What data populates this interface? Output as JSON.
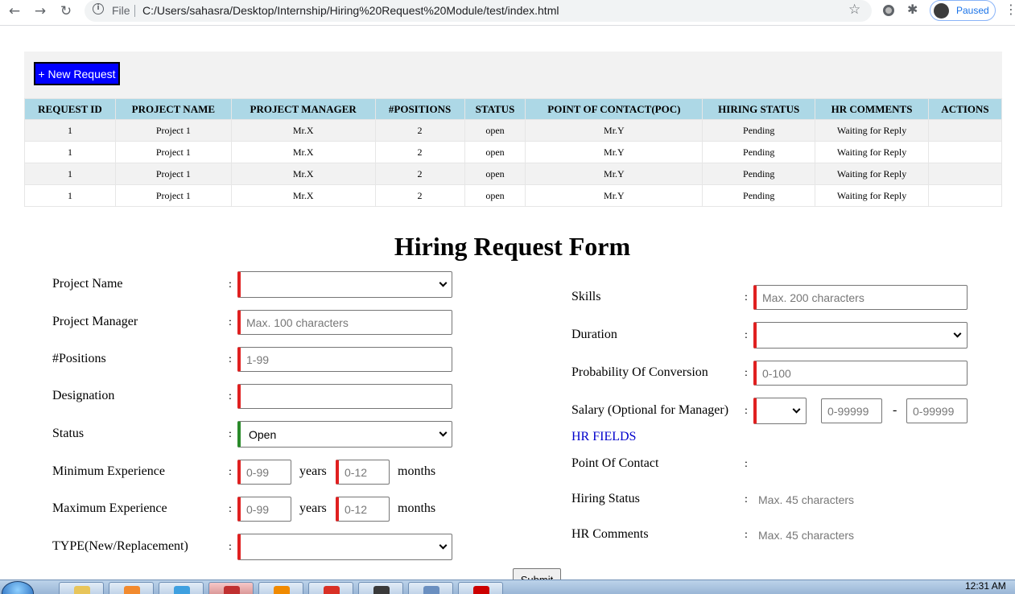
{
  "browser": {
    "file_label": "File",
    "url": "C:/Users/sahasra/Desktop/Internship/Hiring%20Request%20Module/test/index.html",
    "profile_label": "Paused"
  },
  "toolbar": {
    "new_request_label": "+ New Request"
  },
  "table": {
    "headers": [
      "REQUEST ID",
      "PROJECT NAME",
      "PROJECT MANAGER",
      "#POSITIONS",
      "STATUS",
      "POINT OF CONTACT(POC)",
      "HIRING STATUS",
      "HR COMMENTS",
      "ACTIONS"
    ],
    "rows": [
      [
        "1",
        "Project 1",
        "Mr.X",
        "2",
        "open",
        "Mr.Y",
        "Pending",
        "Waiting for Reply",
        ""
      ],
      [
        "1",
        "Project 1",
        "Mr.X",
        "2",
        "open",
        "Mr.Y",
        "Pending",
        "Waiting for Reply",
        ""
      ],
      [
        "1",
        "Project 1",
        "Mr.X",
        "2",
        "open",
        "Mr.Y",
        "Pending",
        "Waiting for Reply",
        ""
      ],
      [
        "1",
        "Project 1",
        "Mr.X",
        "2",
        "open",
        "Mr.Y",
        "Pending",
        "Waiting for Reply",
        ""
      ]
    ]
  },
  "form": {
    "title": "Hiring Request Form",
    "colon": ":",
    "years_label": "years",
    "months_label": "months",
    "left": {
      "project_name": {
        "label": "Project Name",
        "value": ""
      },
      "project_manager": {
        "label": "Project Manager",
        "placeholder": "Max. 100 characters"
      },
      "positions": {
        "label": "#Positions",
        "placeholder": "1-99"
      },
      "designation": {
        "label": "Designation",
        "value": ""
      },
      "status": {
        "label": "Status",
        "value": "Open"
      },
      "min_experience": {
        "label": "Minimum Experience",
        "years_placeholder": "0-99",
        "months_placeholder": "0-12"
      },
      "max_experience": {
        "label": "Maximum Experience",
        "years_placeholder": "0-99",
        "months_placeholder": "0-12"
      },
      "type": {
        "label": "TYPE(New/Replacement)",
        "value": ""
      }
    },
    "right": {
      "skills": {
        "label": "Skills",
        "placeholder": "Max. 200 characters"
      },
      "duration": {
        "label": "Duration",
        "value": ""
      },
      "probability": {
        "label": "Probability Of Conversion",
        "placeholder": "0-100"
      },
      "salary": {
        "label": "Salary (Optional for Manager)",
        "currency_value": "",
        "min_placeholder": "0-99999",
        "max_placeholder": "0-99999",
        "dash": "-"
      }
    },
    "hr_fields": {
      "heading": "HR FIELDS",
      "point_of_contact": {
        "label": "Point Of Contact",
        "value": ""
      },
      "hiring_status": {
        "label": "Hiring Status",
        "placeholder": "Max. 45 characters"
      },
      "hr_comments": {
        "label": "HR Comments",
        "placeholder": "Max. 45 characters"
      }
    },
    "submit_label": "Submit"
  },
  "taskbar": {
    "clock": "12:31 AM"
  },
  "colors": {
    "accent_blue": "#0000ff",
    "table_header": "#add8e6",
    "required_marker": "#e02020",
    "valid_marker": "#2a8a2a"
  }
}
